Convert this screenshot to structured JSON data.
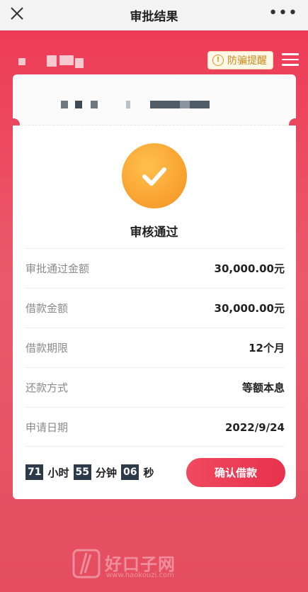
{
  "header": {
    "title": "审批结果",
    "more_icon": "more-dots-icon"
  },
  "anti_fraud": {
    "label": "防骗提醒",
    "icon": "!"
  },
  "status": {
    "text": "审核通过"
  },
  "details": [
    {
      "label": "审批通过金额",
      "value": "30,000.00元"
    },
    {
      "label": "借款金额",
      "value": "30,000.00元"
    },
    {
      "label": "借款期限",
      "value": "12个月"
    },
    {
      "label": "还款方式",
      "value": "等额本息"
    },
    {
      "label": "申请日期",
      "value": "2022/9/24"
    }
  ],
  "countdown": {
    "hours": "71",
    "hours_unit": "小时",
    "minutes": "55",
    "minutes_unit": "分钟",
    "seconds": "06",
    "seconds_unit": "秒"
  },
  "confirm_button": {
    "label": "确认借款"
  },
  "watermark": {
    "text": "好口子网",
    "url": "www.haokouzi.com"
  },
  "colors": {
    "brand_red": "#ee3c58",
    "success_orange": "#f9a431",
    "timer_dark": "#2d3a4a"
  }
}
